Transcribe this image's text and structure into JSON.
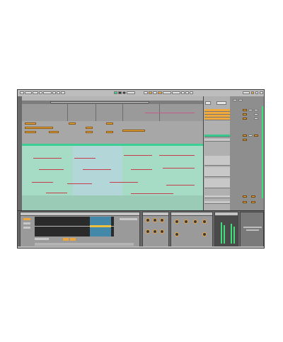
{
  "window": {
    "title": ""
  },
  "transport": {
    "tempo": "",
    "time_signature": "",
    "position": ""
  },
  "colors": {
    "accent_orange": "#f2a93b",
    "accent_green": "#3ccf95",
    "midi_note_red": "#c63c4a",
    "selection_blue": "#b7d6de"
  },
  "icons": {
    "play": "play-icon",
    "stop": "stop-icon",
    "record": "record-icon"
  },
  "tracks": [
    {
      "color": "orange"
    },
    {
      "color": "orange"
    },
    {
      "color": "orange"
    },
    {
      "color": "orange"
    },
    {
      "color": "green"
    },
    {
      "color": "gray"
    },
    {
      "color": "gray"
    },
    {
      "color": "gray"
    }
  ],
  "devices": [
    {
      "panel": "clip"
    },
    {
      "panel": "instrument"
    },
    {
      "panel": "effect"
    },
    {
      "panel": "mixer"
    }
  ],
  "statusbar": {
    "text": ""
  }
}
